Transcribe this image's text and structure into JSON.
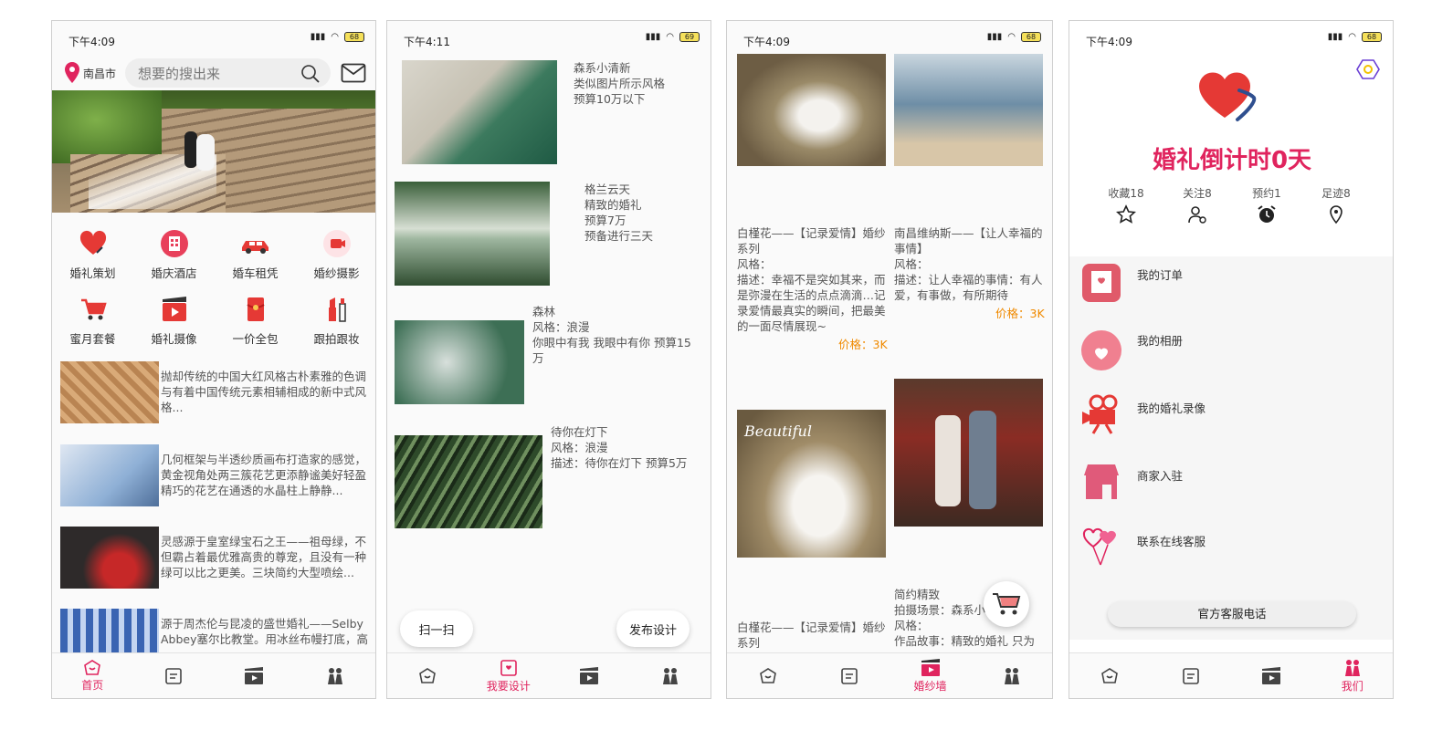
{
  "screens": {
    "home": {
      "status_time": "下午4:09",
      "battery": "68",
      "city": "南昌市",
      "search_placeholder": "想要的搜出来",
      "categories": [
        {
          "label": "婚礼策划"
        },
        {
          "label": "婚庆酒店"
        },
        {
          "label": "婚车租凭"
        },
        {
          "label": "婚纱摄影"
        },
        {
          "label": "蜜月套餐"
        },
        {
          "label": "婚礼摄像"
        },
        {
          "label": "一价全包"
        },
        {
          "label": "跟拍跟妆"
        }
      ],
      "articles": [
        {
          "text": "抛却传统的中国大红风格古朴素雅的色调与有着中国传统元素相辅相成的新中式风格..."
        },
        {
          "text": "几何框架与半透纱质画布打造家的感觉，黄金视角处两三簇花艺更添静谧美好轻盈精巧的花艺在通透的水晶柱上静静..."
        },
        {
          "text": "灵感源于皇室绿宝石之王——祖母绿，不但霸占着最优雅高贵的尊宠，且没有一种绿可以比之更美。三块简约大型喷绘..."
        },
        {
          "text": "源于周杰伦与昆凌的盛世婚礼——Selby Abbey塞尔比教堂。用冰丝布幔打底，高"
        }
      ],
      "tab_active_label": "首页"
    },
    "design": {
      "status_time": "下午4:11",
      "battery": "69",
      "items": [
        {
          "text": "森系小清新\n类似图片所示风格\n 预算10万以下"
        },
        {
          "text": "格兰云天\n 精致的婚礼\n 预算7万\n 预备进行三天"
        },
        {
          "text": " 森林\n风格：浪漫\n 你眼中有我 我眼中有你 预算15万"
        },
        {
          "text": "待你在灯下\n风格：浪漫\n描述：待你在灯下  预算5万"
        }
      ],
      "scan_label": "扫一扫",
      "publish_label": "发布设计",
      "tab_active_label": "我要设计"
    },
    "gallery": {
      "status_time": "下午4:09",
      "battery": "68",
      "left_card": {
        "text": "白槿花——【记录爱情】婚纱系列\n风格：\n描述：幸福不是突如其来，而是弥漫在生活的点点滴滴…记录爱情最真实的瞬间，把最美的一面尽情展现~",
        "price": "价格：3K"
      },
      "right_card": {
        "text": "南昌维纳斯——【让人幸福的事情】\n风格：\n描述：让人幸福的事情：有人爱，有事做，有所期待",
        "price": "价格：3K"
      },
      "left_card2_text": "白槿花——【记录爱情】婚纱系列",
      "right_card2_text": "简约精致\n拍摄场景：森系小清新\n风格：\n作品故事：精致的婚礼 只为",
      "photo_caption": "Beautiful",
      "tab_active_label": "婚纱墙"
    },
    "profile": {
      "status_time": "下午4:09",
      "battery": "68",
      "countdown": "婚礼倒计时0天",
      "stats": [
        {
          "label": "收藏18"
        },
        {
          "label": "关注8"
        },
        {
          "label": "预约1"
        },
        {
          "label": "足迹8"
        }
      ],
      "menu": [
        {
          "label": "我的订单"
        },
        {
          "label": "我的相册"
        },
        {
          "label": "我的婚礼录像"
        },
        {
          "label": "商家入驻"
        },
        {
          "label": "联系在线客服"
        }
      ],
      "service_phone_label": "官方客服电话",
      "tab_active_label": "我们"
    }
  },
  "colors": {
    "accent": "#e0245e",
    "price": "#f08a00"
  }
}
